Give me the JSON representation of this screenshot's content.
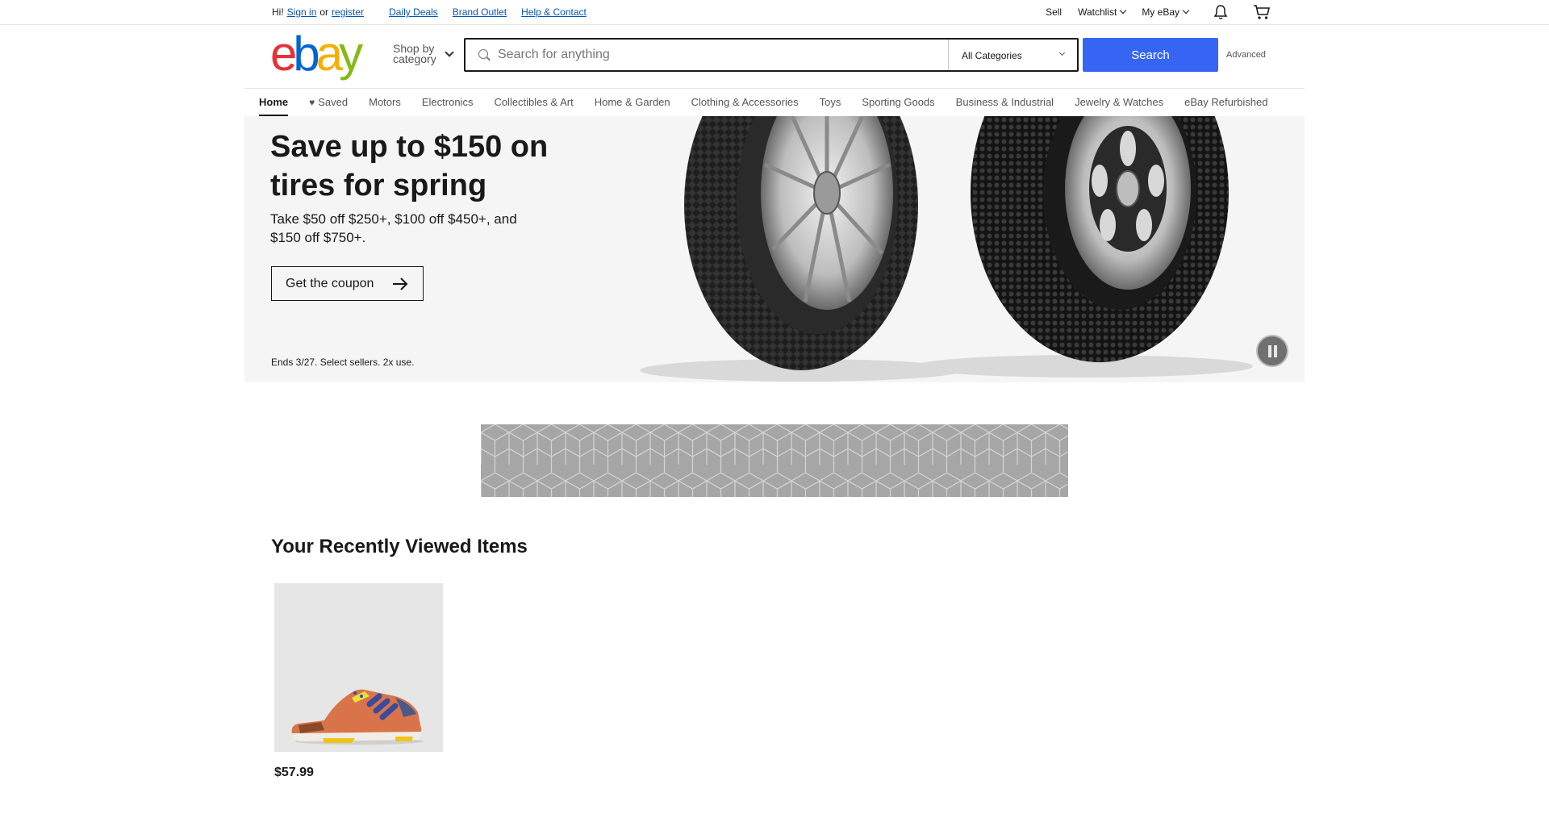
{
  "topbar": {
    "greeting": "Hi!",
    "sign_in": "Sign in",
    "or": "or",
    "register": "register",
    "links": [
      "Daily Deals",
      "Brand Outlet",
      "Help & Contact"
    ],
    "sell": "Sell",
    "watchlist": "Watchlist",
    "my_ebay": "My eBay"
  },
  "header": {
    "shop_by_line1": "Shop by",
    "shop_by_line2": "category",
    "search_placeholder": "Search for anything",
    "category_selected": "All Categories",
    "search_button": "Search",
    "advanced": "Advanced",
    "logo_colors": [
      "#e53238",
      "#0064d2",
      "#f5af02",
      "#86b817"
    ]
  },
  "catnav": {
    "items": [
      "Home",
      "Saved",
      "Motors",
      "Electronics",
      "Collectibles & Art",
      "Home & Garden",
      "Clothing & Accessories",
      "Toys",
      "Sporting Goods",
      "Business & Industrial",
      "Jewelry & Watches",
      "eBay Refurbished"
    ]
  },
  "hero": {
    "title": "Save up to $150 on tires for spring",
    "subtitle": "Take $50 off $250+, $100 off $450+, and $150 off $750+.",
    "cta": "Get the coupon",
    "fine_print": "Ends 3/27. Select sellers. 2x use."
  },
  "recently_viewed": {
    "title": "Your Recently Viewed Items",
    "items": [
      {
        "price": "$57.99"
      }
    ]
  },
  "colors": {
    "accent": "#3665f3",
    "text": "#191919"
  }
}
